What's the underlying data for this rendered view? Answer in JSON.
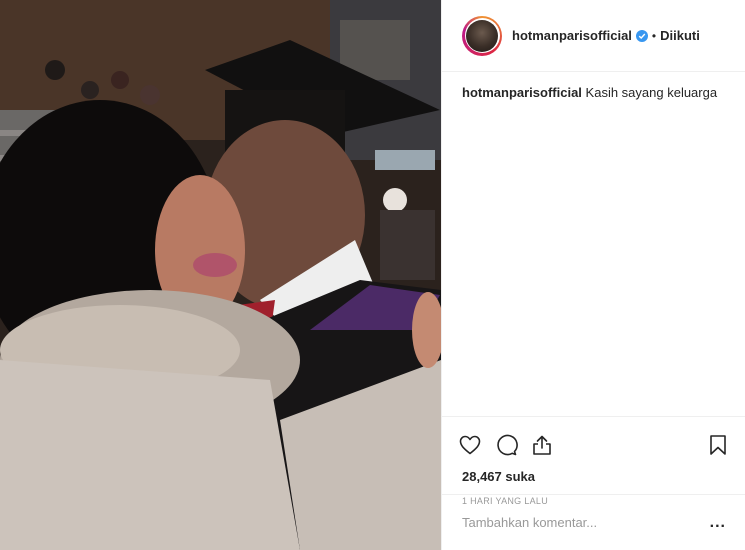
{
  "post": {
    "username": "hotmanparisofficial",
    "dot": "•",
    "follow_status": "Diikuti",
    "caption_username": "hotmanparisofficial",
    "caption_text": "Kasih sayang keluarga",
    "likes": "28,467 suka",
    "time": "1 HARI YANG LALU"
  },
  "comment": {
    "placeholder": "Tambahkan komentar...",
    "more": "..."
  },
  "colors": {
    "verified": "#3897f0",
    "border": "#efefef",
    "muted": "#999999"
  },
  "icons": [
    "heart-icon",
    "comment-icon",
    "share-icon",
    "bookmark-icon",
    "verified-badge-icon",
    "more-options-icon"
  ]
}
